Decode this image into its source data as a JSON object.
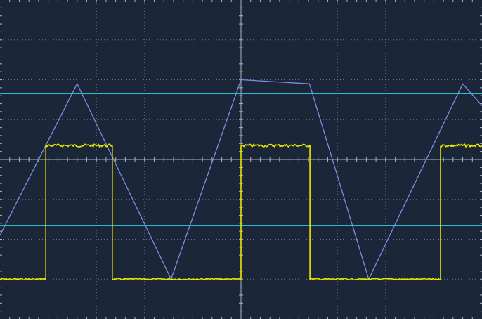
{
  "display": {
    "background": "#1b2639",
    "grid_color": "#7f8ea3",
    "axis_color": "#a9b6c8",
    "divisions_x": 10,
    "divisions_y": 8,
    "minor_per_division": 5
  },
  "chart_data": {
    "type": "line",
    "title": "",
    "xlabel": "",
    "ylabel": "",
    "x_unit": "div",
    "y_unit": "div",
    "xlim": [
      -5,
      5
    ],
    "ylim": [
      -4,
      4
    ],
    "grid": true,
    "series": [
      {
        "color": "#7a8fe0",
        "shape": "triangle",
        "x": [
          -5.0,
          -3.4,
          -1.45,
          0.0,
          1.42,
          2.65,
          4.6,
          5.0
        ],
        "y": [
          -1.9,
          1.9,
          -3.0,
          2.0,
          1.9,
          -3.0,
          1.9,
          1.35
        ]
      },
      {
        "color": "#e8e800",
        "shape": "square",
        "x": [
          -5.0,
          -4.05,
          -4.05,
          -2.67,
          -2.67,
          0.0,
          0.0,
          1.43,
          1.43,
          4.14,
          4.14,
          5.0
        ],
        "y": [
          -3.0,
          -3.0,
          0.35,
          0.35,
          -3.0,
          -3.0,
          0.35,
          0.35,
          -3.0,
          -3.0,
          0.35,
          0.35
        ]
      }
    ],
    "cursors": {
      "color": "#2ad4e0",
      "y": [
        1.65,
        -1.65
      ]
    }
  }
}
